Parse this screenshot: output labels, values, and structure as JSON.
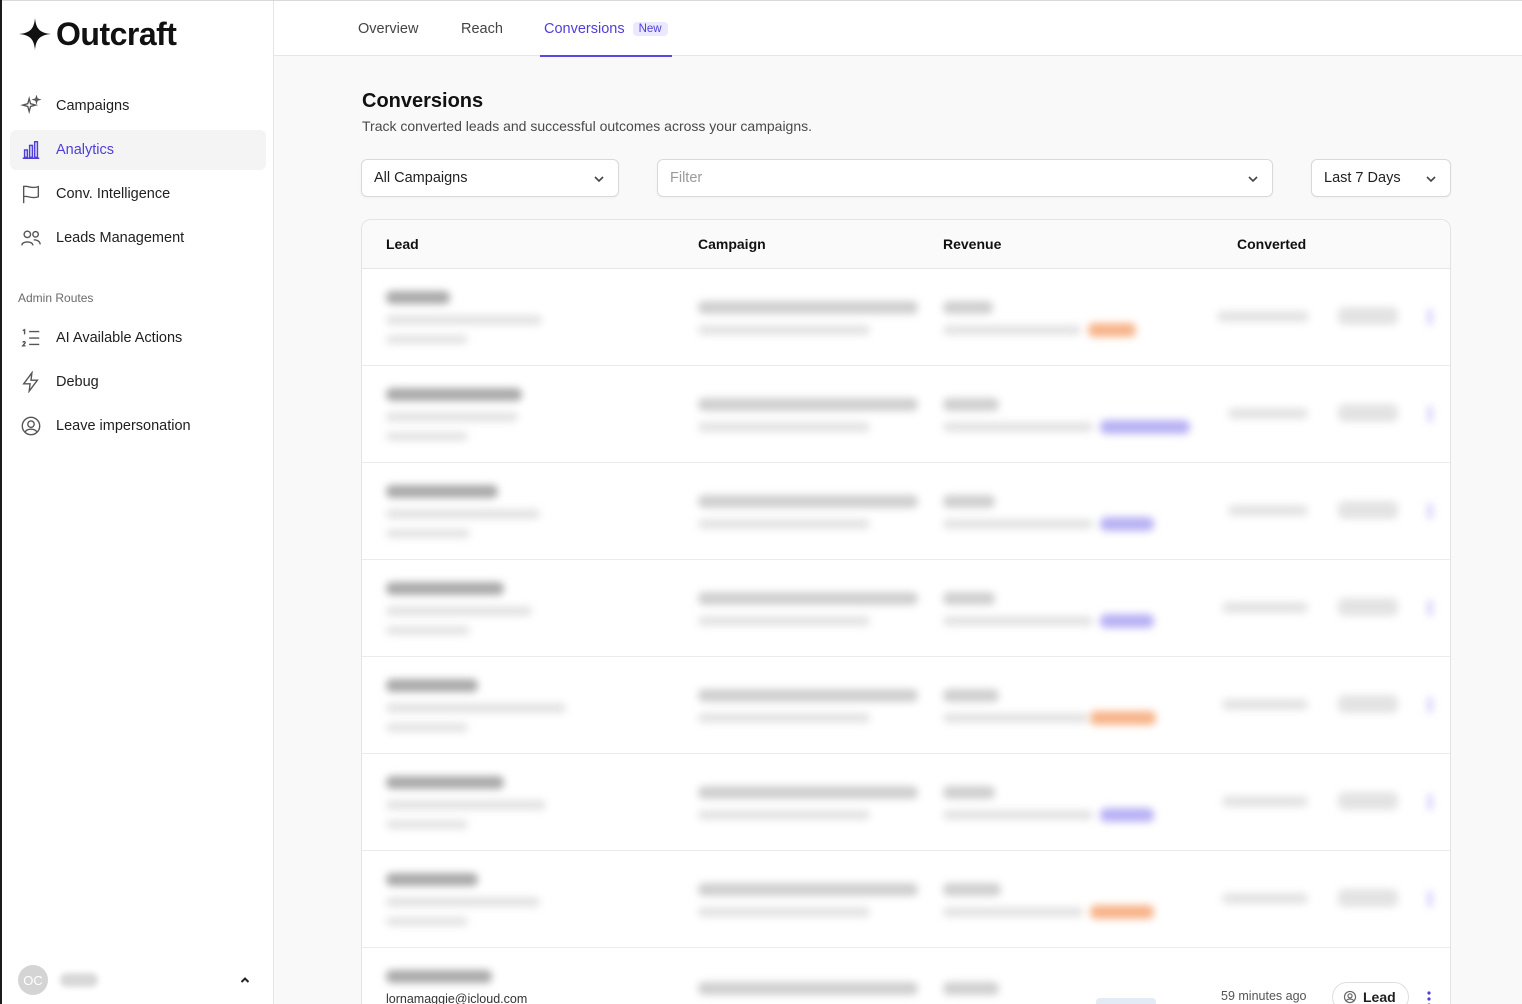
{
  "brand": {
    "name": "Outcraft"
  },
  "sidebar": {
    "items": [
      {
        "label": "Campaigns",
        "icon": "sparkles-icon",
        "active": false
      },
      {
        "label": "Analytics",
        "icon": "bar-chart-icon",
        "active": true
      },
      {
        "label": "Conv. Intelligence",
        "icon": "flag-icon",
        "active": false
      },
      {
        "label": "Leads Management",
        "icon": "users-icon",
        "active": false
      }
    ],
    "section_label": "Admin Routes",
    "admin_items": [
      {
        "label": "AI Available Actions",
        "icon": "list-ordered-icon"
      },
      {
        "label": "Debug",
        "icon": "lightning-icon"
      },
      {
        "label": "Leave impersonation",
        "icon": "user-circle-icon"
      }
    ],
    "user": {
      "initials": "OC",
      "name": ""
    }
  },
  "tabs": [
    {
      "label": "Overview",
      "active": false
    },
    {
      "label": "Reach",
      "active": false
    },
    {
      "label": "Conversions",
      "active": true,
      "badge": "New"
    }
  ],
  "main": {
    "title": "Conversions",
    "subtitle": "Track converted leads and successful outcomes across your campaigns.",
    "filters": {
      "campaign": "All Campaigns",
      "filter_placeholder": "Filter",
      "date_range": "Last 7 Days"
    },
    "table": {
      "columns": [
        "Lead",
        "Campaign",
        "Revenue",
        "Converted"
      ],
      "visible_row": {
        "email": "lornamaggie@icloud.com",
        "converted": "59 minutes ago",
        "type": "Lead"
      }
    }
  },
  "colors": {
    "accent": "#4f3fd8",
    "badge_bg": "#ebe9ff",
    "pill_orange": "#f7b48a",
    "pill_purple": "#b8b2f4"
  }
}
